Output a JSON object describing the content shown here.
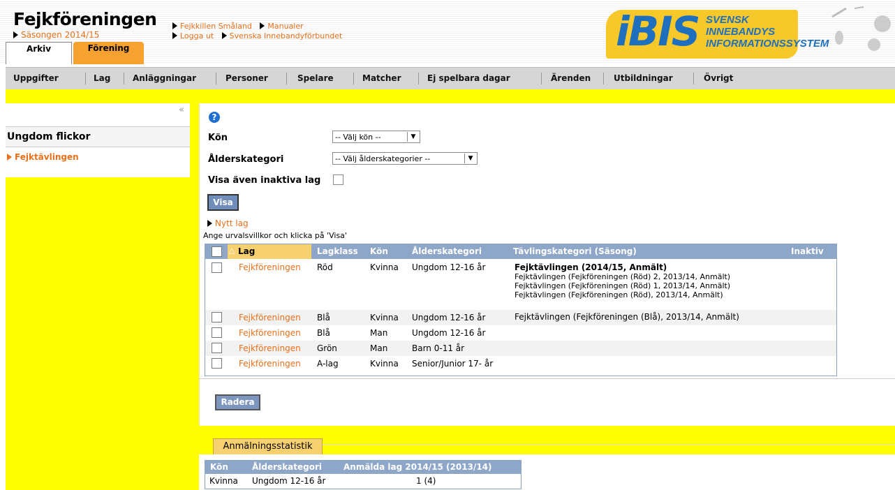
{
  "header": {
    "brand": "Fejkföreningen",
    "season": "Säsongen 2014/15",
    "tabs": [
      "Arkiv",
      "Förening"
    ],
    "links": [
      [
        "Fejkkillen Småland",
        "Manualer"
      ],
      [
        "Logga ut",
        "Svenska Innebandyförbundet"
      ]
    ],
    "logo": {
      "mark": "iBIS",
      "lines": [
        "SVENSK",
        "INNEBANDYS",
        "INFORMATIONSSYSTEM"
      ]
    }
  },
  "nav": [
    "Uppgifter",
    "Lag",
    "Anläggningar",
    "Personer",
    "Spelare",
    "Matcher",
    "Ej spelbara dagar",
    "Ärenden",
    "Utbildningar",
    "Övrigt"
  ],
  "sidebar": {
    "collapse": "«",
    "heading": "Ungdom flickor",
    "item": "Fejktävlingen"
  },
  "filters": {
    "help": "?",
    "kon_label": "Kön",
    "kon_value": "-- Välj kön --",
    "alder_label": "Ålderskategori",
    "alder_value": "-- Välj ålderskategorier --",
    "inaktiva_label": "Visa även inaktiva lag",
    "visa": "Visa",
    "nytt_lag": "Nytt lag",
    "hint": "Ange urvalsvillkor och klicka på 'Visa'"
  },
  "teams": {
    "columns": [
      "Lag",
      "Lagklass",
      "Kön",
      "Ålderskategori",
      "Tävlingskategori (Säsong)",
      "Inaktiv"
    ],
    "rows": [
      {
        "lag": "Fejkföreningen",
        "klass": "Röd",
        "kon": "Kvinna",
        "alder": "Ungdom 12-16 år",
        "tavling_main": "Fejktävlingen (2014/15, Anmält)",
        "tavling": [
          "Fejktävlingen (Fejkföreningen (Röd) 2, 2013/14, Anmält)",
          "Fejktävlingen (Fejkföreningen (Röd) 1, 2013/14, Anmält)",
          "Fejktävlingen (Fejkföreningen (Röd), 2013/14, Anmält)"
        ]
      },
      {
        "lag": "Fejkföreningen",
        "klass": "Blå",
        "kon": "Kvinna",
        "alder": "Ungdom 12-16 år",
        "tavling_main": "",
        "tavling": [
          "Fejktävlingen (Fejkföreningen (Blå), 2013/14, Anmält)"
        ]
      },
      {
        "lag": "Fejkföreningen",
        "klass": "Blå",
        "kon": "Man",
        "alder": "Ungdom 12-16 år",
        "tavling_main": "",
        "tavling": []
      },
      {
        "lag": "Fejkföreningen",
        "klass": "Grön",
        "kon": "Man",
        "alder": "Barn 0-11 år",
        "tavling_main": "",
        "tavling": []
      },
      {
        "lag": "Fejkföreningen",
        "klass": "A-lag",
        "kon": "Kvinna",
        "alder": "Senior/Junior 17- år",
        "tavling_main": "",
        "tavling": []
      }
    ]
  },
  "radera": "Radera",
  "stats": {
    "tab": "Anmälningsstatistik",
    "columns": [
      "Kön",
      "Ålderskategori",
      "Anmälda lag 2014/15 (2013/14)"
    ],
    "row": [
      "Kvinna",
      "Ungdom 12-16 år",
      "1 (4)"
    ]
  },
  "colors": {
    "accent": "#e8701a",
    "tab": "#f7a230",
    "table_head": "#8ea6c8",
    "background": "#ffff00"
  }
}
